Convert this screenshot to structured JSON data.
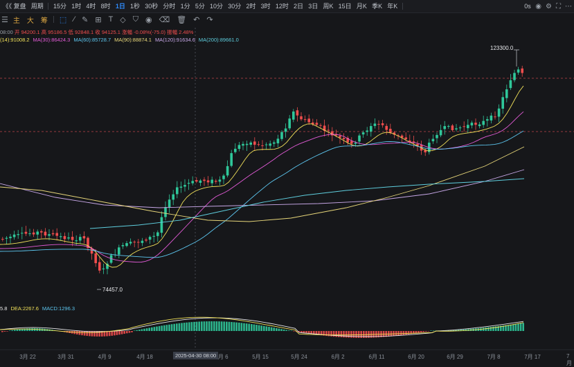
{
  "toolbar": {
    "left_items": [
      "《《 复盘",
      "周期",
      "15分",
      "1时",
      "4时",
      "8时",
      "1日",
      "1秒",
      "30秒",
      "分时",
      "1分",
      "5分",
      "10分",
      "30分",
      "2时",
      "3时",
      "12时",
      "2日",
      "3日",
      "周K",
      "15日",
      "月K",
      "季K",
      "年K"
    ],
    "active": "1日",
    "right_label": "0s"
  },
  "drawbar": {
    "text_tools": [
      "主",
      "大",
      "筹"
    ]
  },
  "info": {
    "ohlc_prefix": "08:00",
    "open": "开 94200.1",
    "high": "高 95186.5",
    "low": "低 92848.1",
    "close": "收 94125.1",
    "change": "涨幅 -0.08%(-75.0)",
    "amplitude": "振幅 2.48%",
    "ma": [
      {
        "label": "(14):91008.2",
        "color": "#f2e25a"
      },
      {
        "label": "MA(30):86424.3",
        "color": "#e35bd7"
      },
      {
        "label": "MA(60):85728.7",
        "color": "#5dc7f0"
      },
      {
        "label": "MA(90):88874.1",
        "color": "#e8d77a"
      },
      {
        "label": "MA(120):91634.6",
        "color": "#c8a8e8"
      },
      {
        "label": "MA(200):89661.0",
        "color": "#5fd0e0"
      }
    ],
    "macd": [
      {
        "label": "5.8",
        "color": "#e8e8e8"
      },
      {
        "label": "DEA:2267.6",
        "color": "#f2e25a"
      },
      {
        "label": "MACD:1296.3",
        "color": "#5dc7f0"
      }
    ]
  },
  "annotations": {
    "high_label": "123300.0",
    "low_label": "74457.0"
  },
  "xaxis": {
    "labels": [
      "3月 22",
      "3月 31",
      "4月 9",
      "4月 18",
      "5月 6",
      "5月 15",
      "5月 24",
      "6月 2",
      "6月 11",
      "6月 20",
      "6月 29",
      "7月 8",
      "7月 17",
      "7月"
    ],
    "crosshair_label": "2025-04-30 08:00"
  },
  "colors": {
    "up": "#ef4d4d",
    "down": "#2fc79a",
    "bg": "#16171a"
  }
}
